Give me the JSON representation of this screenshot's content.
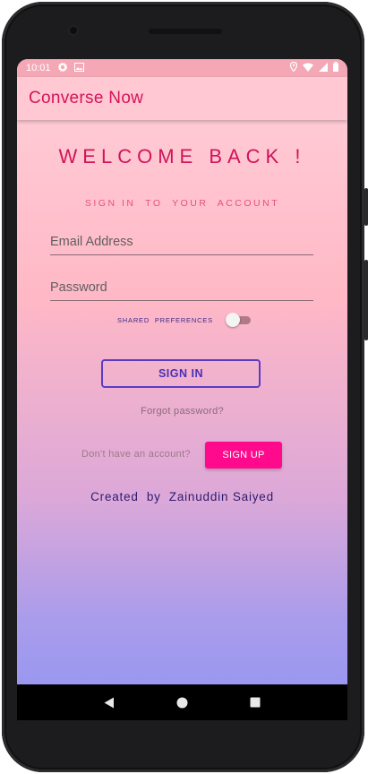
{
  "status_bar": {
    "time": "10:01",
    "left_icons": [
      "gear-icon",
      "image-icon"
    ],
    "right_icons": [
      "location-icon",
      "wifi-icon",
      "signal-icon",
      "battery-icon"
    ]
  },
  "app_bar": {
    "title": "Converse Now"
  },
  "login": {
    "heading": "WELCOME BACK !",
    "subtitle": "SIGN IN  TO  YOUR  ACCOUNT",
    "email": {
      "placeholder": "Email Address",
      "value": ""
    },
    "password": {
      "placeholder": "Password",
      "value": ""
    },
    "shared_pref_label": "SHARED  PREFERENCES",
    "shared_pref_on": false,
    "signin_label": "SIGN IN",
    "forgot_label": "Forgot password?",
    "no_account_label": "Don't have an account?",
    "signup_label": "SIGN UP",
    "created_by": "Created  by  Zainuddin Saiyed"
  },
  "colors": {
    "accent": "#d4145a",
    "signup_button": "#ff0a8c",
    "signin_border": "#5a3cc4",
    "gradient_top": "#ffd0d9",
    "gradient_bottom": "#9a98f0"
  },
  "nav_bar": {
    "buttons": [
      "back-icon",
      "home-icon",
      "recents-icon"
    ]
  }
}
